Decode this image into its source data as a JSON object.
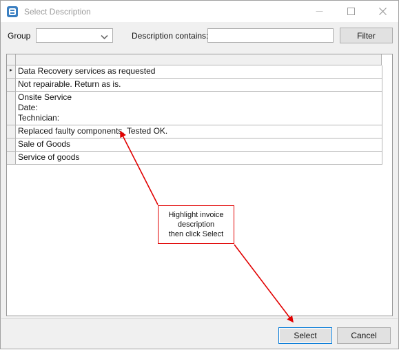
{
  "window": {
    "title": "Select Description",
    "icon": "app-window-icon",
    "controls": {
      "minimize": "minimize-icon",
      "maximize": "maximize-icon",
      "close": "close-icon"
    }
  },
  "toolbar": {
    "group_label": "Group",
    "group_value": "",
    "group_chevron": "chevron-down-icon",
    "description_label": "Description contains:",
    "description_value": "",
    "description_placeholder": "",
    "filter_label": "Filter"
  },
  "grid": {
    "header_label": "",
    "rows": [
      {
        "marker": "▸",
        "text": "Data Recovery services as requested",
        "selected": true
      },
      {
        "marker": "",
        "text": "Not repairable. Return as is.",
        "selected": false
      },
      {
        "marker": "",
        "text": "Onsite Service\nDate:\nTechnician:",
        "selected": false
      },
      {
        "marker": "",
        "text": "Replaced faulty components. Tested OK.",
        "selected": false
      },
      {
        "marker": "",
        "text": "Sale of Goods",
        "selected": false
      },
      {
        "marker": "",
        "text": "Service of goods",
        "selected": false
      }
    ]
  },
  "footer": {
    "select_label": "Select",
    "cancel_label": "Cancel"
  },
  "annotation": {
    "callout_line1": "Highlight invoice",
    "callout_line2": "description",
    "callout_line3": "then click Select",
    "color": "#e10000"
  }
}
